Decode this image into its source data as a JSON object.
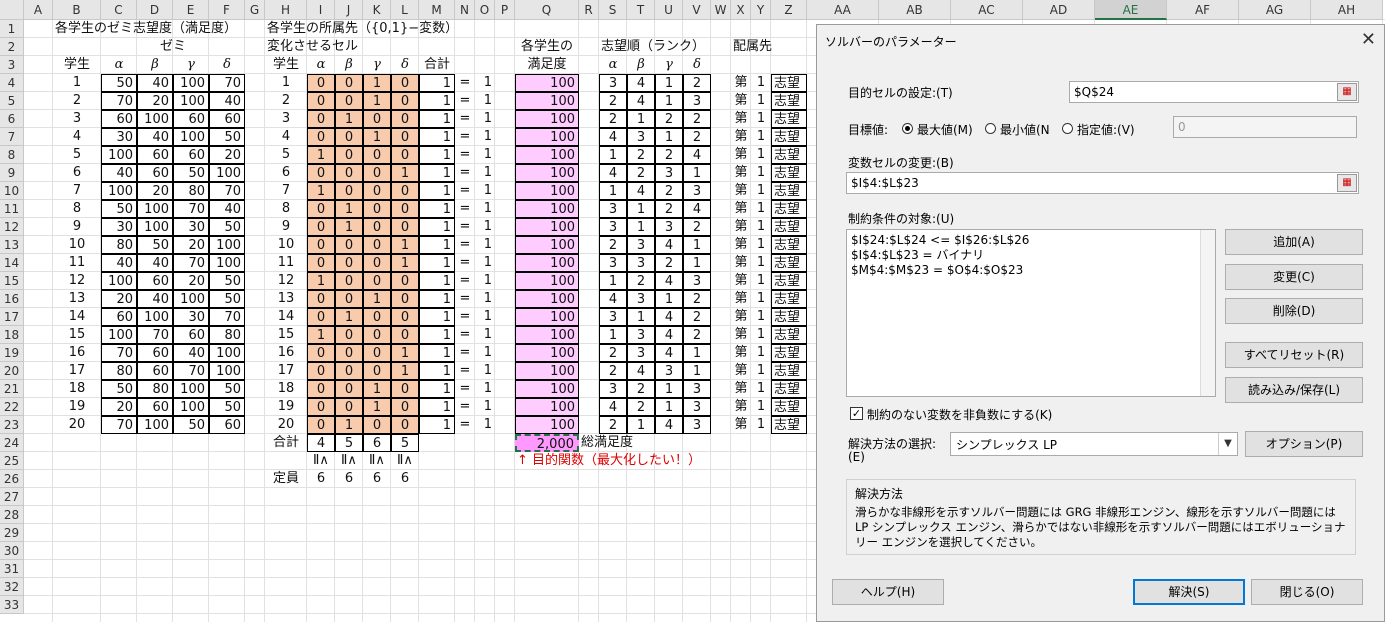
{
  "columns": [
    "A",
    "B",
    "C",
    "D",
    "E",
    "F",
    "G",
    "H",
    "I",
    "J",
    "K",
    "L",
    "M",
    "N",
    "O",
    "P",
    "Q",
    "R",
    "S",
    "T",
    "U",
    "V",
    "W",
    "X",
    "Y",
    "Z",
    "AA",
    "AB",
    "AC",
    "AD",
    "AE",
    "AF",
    "AG",
    "AH"
  ],
  "selected_column": "AE",
  "rows": [
    "1",
    "2",
    "3",
    "4",
    "5",
    "6",
    "7",
    "8",
    "9",
    "10",
    "11",
    "12",
    "13",
    "14",
    "15",
    "16",
    "17",
    "18",
    "19",
    "20",
    "21",
    "22",
    "23",
    "24",
    "25",
    "26",
    "27",
    "28",
    "29",
    "30",
    "31",
    "32",
    "33"
  ],
  "sheet": {
    "title1": "各学生のゼミ志望度（満足度）",
    "zemi": "ゼミ",
    "student": "学生",
    "greek": [
      "α",
      "β",
      "γ",
      "δ"
    ],
    "title2": "各学生の所属先（{0,1}−変数）",
    "change_cells": "変化させるセル",
    "total": "合計",
    "eq": "=",
    "one": "1",
    "title3a": "各学生の",
    "title3b": "満足度",
    "title4": "志望順（ランク）",
    "title5": "配属先",
    "dai": "第",
    "shibo": "志望",
    "sum_label": "合計",
    "col_totals": [
      "4",
      "5",
      "6",
      "5"
    ],
    "leq": "Ⅱ∧",
    "teiin": "定員",
    "capacities": [
      "6",
      "6",
      "6",
      "6"
    ],
    "total_satisfaction": "2,000",
    "total_satisfaction_label": "総満足度",
    "objective_note": "↑ 目的関数（最大化したい！）",
    "students": [
      {
        "id": "1",
        "pref": [
          "50",
          "40",
          "100",
          "70"
        ],
        "assign": [
          "0",
          "0",
          "1",
          "0"
        ],
        "sat": "100",
        "rank": [
          "3",
          "4",
          "1",
          "2"
        ]
      },
      {
        "id": "2",
        "pref": [
          "70",
          "20",
          "100",
          "40"
        ],
        "assign": [
          "0",
          "0",
          "1",
          "0"
        ],
        "sat": "100",
        "rank": [
          "2",
          "4",
          "1",
          "3"
        ]
      },
      {
        "id": "3",
        "pref": [
          "60",
          "100",
          "60",
          "60"
        ],
        "assign": [
          "0",
          "1",
          "0",
          "0"
        ],
        "sat": "100",
        "rank": [
          "2",
          "1",
          "2",
          "2"
        ]
      },
      {
        "id": "4",
        "pref": [
          "30",
          "40",
          "100",
          "50"
        ],
        "assign": [
          "0",
          "0",
          "1",
          "0"
        ],
        "sat": "100",
        "rank": [
          "4",
          "3",
          "1",
          "2"
        ]
      },
      {
        "id": "5",
        "pref": [
          "100",
          "60",
          "60",
          "20"
        ],
        "assign": [
          "1",
          "0",
          "0",
          "0"
        ],
        "sat": "100",
        "rank": [
          "1",
          "2",
          "2",
          "4"
        ]
      },
      {
        "id": "6",
        "pref": [
          "40",
          "60",
          "50",
          "100"
        ],
        "assign": [
          "0",
          "0",
          "0",
          "1"
        ],
        "sat": "100",
        "rank": [
          "4",
          "2",
          "3",
          "1"
        ]
      },
      {
        "id": "7",
        "pref": [
          "100",
          "20",
          "80",
          "70"
        ],
        "assign": [
          "1",
          "0",
          "0",
          "0"
        ],
        "sat": "100",
        "rank": [
          "1",
          "4",
          "2",
          "3"
        ]
      },
      {
        "id": "8",
        "pref": [
          "50",
          "100",
          "70",
          "40"
        ],
        "assign": [
          "0",
          "1",
          "0",
          "0"
        ],
        "sat": "100",
        "rank": [
          "3",
          "1",
          "2",
          "4"
        ]
      },
      {
        "id": "9",
        "pref": [
          "30",
          "100",
          "30",
          "50"
        ],
        "assign": [
          "0",
          "1",
          "0",
          "0"
        ],
        "sat": "100",
        "rank": [
          "3",
          "1",
          "3",
          "2"
        ]
      },
      {
        "id": "10",
        "pref": [
          "80",
          "50",
          "20",
          "100"
        ],
        "assign": [
          "0",
          "0",
          "0",
          "1"
        ],
        "sat": "100",
        "rank": [
          "2",
          "3",
          "4",
          "1"
        ]
      },
      {
        "id": "11",
        "pref": [
          "40",
          "40",
          "70",
          "100"
        ],
        "assign": [
          "0",
          "0",
          "0",
          "1"
        ],
        "sat": "100",
        "rank": [
          "3",
          "3",
          "2",
          "1"
        ]
      },
      {
        "id": "12",
        "pref": [
          "100",
          "60",
          "20",
          "50"
        ],
        "assign": [
          "1",
          "0",
          "0",
          "0"
        ],
        "sat": "100",
        "rank": [
          "1",
          "2",
          "4",
          "3"
        ]
      },
      {
        "id": "13",
        "pref": [
          "20",
          "40",
          "100",
          "50"
        ],
        "assign": [
          "0",
          "0",
          "1",
          "0"
        ],
        "sat": "100",
        "rank": [
          "4",
          "3",
          "1",
          "2"
        ]
      },
      {
        "id": "14",
        "pref": [
          "60",
          "100",
          "30",
          "70"
        ],
        "assign": [
          "0",
          "1",
          "0",
          "0"
        ],
        "sat": "100",
        "rank": [
          "3",
          "1",
          "4",
          "2"
        ]
      },
      {
        "id": "15",
        "pref": [
          "100",
          "70",
          "60",
          "80"
        ],
        "assign": [
          "1",
          "0",
          "0",
          "0"
        ],
        "sat": "100",
        "rank": [
          "1",
          "3",
          "4",
          "2"
        ]
      },
      {
        "id": "16",
        "pref": [
          "70",
          "60",
          "40",
          "100"
        ],
        "assign": [
          "0",
          "0",
          "0",
          "1"
        ],
        "sat": "100",
        "rank": [
          "2",
          "3",
          "4",
          "1"
        ]
      },
      {
        "id": "17",
        "pref": [
          "80",
          "60",
          "70",
          "100"
        ],
        "assign": [
          "0",
          "0",
          "0",
          "1"
        ],
        "sat": "100",
        "rank": [
          "2",
          "4",
          "3",
          "1"
        ]
      },
      {
        "id": "18",
        "pref": [
          "50",
          "80",
          "100",
          "50"
        ],
        "assign": [
          "0",
          "0",
          "1",
          "0"
        ],
        "sat": "100",
        "rank": [
          "3",
          "2",
          "1",
          "3"
        ]
      },
      {
        "id": "19",
        "pref": [
          "20",
          "60",
          "100",
          "50"
        ],
        "assign": [
          "0",
          "0",
          "1",
          "0"
        ],
        "sat": "100",
        "rank": [
          "4",
          "2",
          "1",
          "3"
        ]
      },
      {
        "id": "20",
        "pref": [
          "70",
          "100",
          "50",
          "60"
        ],
        "assign": [
          "0",
          "1",
          "0",
          "0"
        ],
        "sat": "100",
        "rank": [
          "2",
          "1",
          "4",
          "3"
        ]
      }
    ]
  },
  "dialog": {
    "title": "ソルバーのパラメーター",
    "objective_label": "目的セルの設定:(T)",
    "objective_value": "$Q$24",
    "target_label": "目標値:",
    "opt_max": "最大値(M)",
    "opt_min": "最小値(N",
    "opt_value": "指定値:(V)",
    "value_of": "0",
    "var_cells_label": "変数セルの変更:(B)",
    "var_cells_value": "$I$4:$L$23",
    "constraints_label": "制約条件の対象:(U)",
    "constraints": [
      "$I$24:$L$24 <= $I$26:$L$26",
      "$I$4:$L$23 = バイナリ",
      "$M$4:$M$23 = $O$4:$O$23"
    ],
    "btn_add": "追加(A)",
    "btn_change": "変更(C)",
    "btn_delete": "削除(D)",
    "btn_reset": "すべてリセット(R)",
    "btn_load": "読み込み/保存(L)",
    "nonneg_label": "制約のない変数を非負数にする(K)",
    "method_label": "解決方法の選択:",
    "method_label2": "(E)",
    "method_value": "シンプレックス LP",
    "btn_options": "オプション(P)",
    "method_group_title": "解決方法",
    "method_desc": "滑らかな非線形を示すソルバー問題には GRG 非線形エンジン、線形を示すソルバー問題には LP シンプレックス エンジン、滑らかではない非線形を示すソルバー問題にはエボリューショナリー エンジンを選択してください。",
    "btn_help": "ヘルプ(H)",
    "btn_solve": "解決(S)",
    "btn_close": "閉じる(O)"
  }
}
